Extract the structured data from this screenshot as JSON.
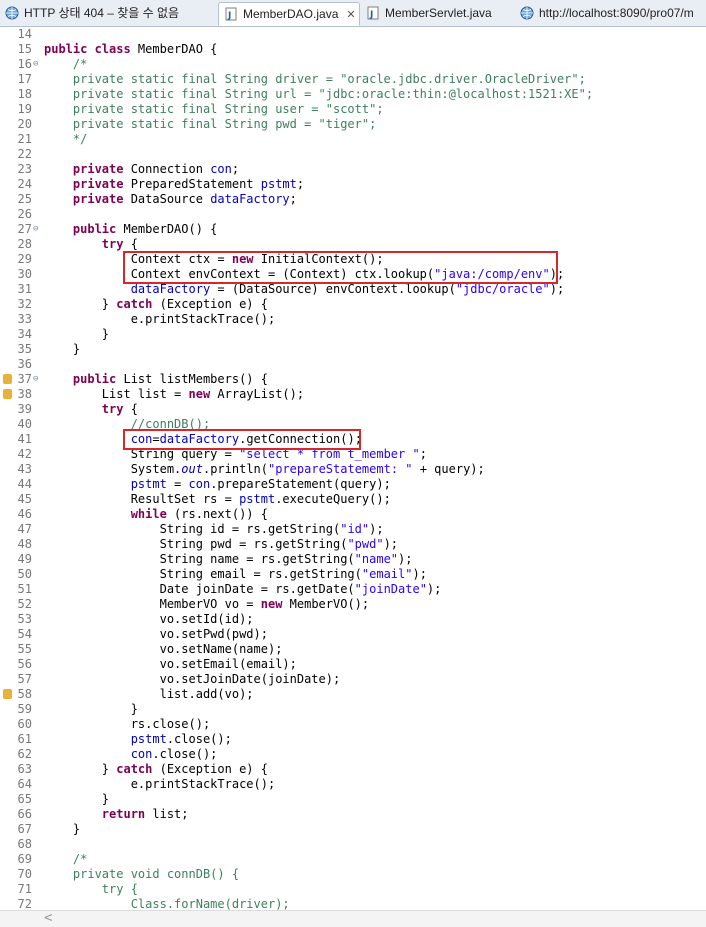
{
  "tabs": [
    {
      "label": "HTTP 상태 404 – 찾을 수 없음",
      "icon": "globe-icon",
      "active": false
    },
    {
      "label": "MemberDAO.java",
      "icon": "java-file-icon",
      "active": true,
      "close": "✕"
    },
    {
      "label": "MemberServlet.java",
      "icon": "java-file-icon",
      "active": false
    },
    {
      "label": "http://localhost:8090/pro07/m",
      "icon": "globe-icon",
      "active": false
    }
  ],
  "editor": {
    "lines": [
      {
        "n": "14",
        "t": []
      },
      {
        "n": "15",
        "t": [
          [
            "kw",
            "public class "
          ],
          [
            "",
            "MemberDAO {"
          ]
        ]
      },
      {
        "n": "16",
        "fold": true,
        "t": [
          [
            "cm",
            "    /*"
          ]
        ]
      },
      {
        "n": "17",
        "t": [
          [
            "cm",
            "    private static final String driver = \"oracle.jdbc.driver.OracleDriver\";"
          ]
        ]
      },
      {
        "n": "18",
        "t": [
          [
            "cm",
            "    private static final String url = \"jdbc:oracle:thin:@localhost:1521:XE\";"
          ]
        ]
      },
      {
        "n": "19",
        "t": [
          [
            "cm",
            "    private static final String user = \"scott\";"
          ]
        ]
      },
      {
        "n": "20",
        "t": [
          [
            "cm",
            "    private static final String pwd = \"tiger\";"
          ]
        ]
      },
      {
        "n": "21",
        "t": [
          [
            "cm",
            "    */"
          ]
        ]
      },
      {
        "n": "22",
        "t": []
      },
      {
        "n": "23",
        "t": [
          [
            "kw",
            "    private "
          ],
          [
            "",
            "Connection "
          ],
          [
            "fld",
            "con"
          ],
          [
            "",
            ";"
          ]
        ]
      },
      {
        "n": "24",
        "t": [
          [
            "kw",
            "    private "
          ],
          [
            "",
            "PreparedStatement "
          ],
          [
            "fld",
            "pstmt"
          ],
          [
            "",
            ";"
          ]
        ]
      },
      {
        "n": "25",
        "t": [
          [
            "kw",
            "    private "
          ],
          [
            "",
            "DataSource "
          ],
          [
            "fld",
            "dataFactory"
          ],
          [
            "",
            ";"
          ]
        ]
      },
      {
        "n": "26",
        "t": []
      },
      {
        "n": "27",
        "fold": true,
        "t": [
          [
            "kw",
            "    public "
          ],
          [
            "",
            "MemberDAO() {"
          ]
        ]
      },
      {
        "n": "28",
        "t": [
          [
            "kw",
            "        try "
          ],
          [
            "",
            "{"
          ]
        ]
      },
      {
        "n": "29",
        "t": [
          [
            "",
            "            Context ctx = "
          ],
          [
            "kw",
            "new "
          ],
          [
            "",
            "InitialContext();"
          ]
        ]
      },
      {
        "n": "30",
        "t": [
          [
            "",
            "            Context envContext = (Context) ctx.lookup("
          ],
          [
            "str",
            "\"java:/comp/env\""
          ],
          [
            "",
            ");"
          ]
        ]
      },
      {
        "n": "31",
        "t": [
          [
            "fld",
            "            dataFactory"
          ],
          [
            "",
            " = (DataSource) envContext.lookup("
          ],
          [
            "str",
            "\"jdbc/oracle\""
          ],
          [
            "",
            ");"
          ]
        ]
      },
      {
        "n": "32",
        "t": [
          [
            "",
            "        } "
          ],
          [
            "kw",
            "catch "
          ],
          [
            "",
            "(Exception e) {"
          ]
        ]
      },
      {
        "n": "33",
        "t": [
          [
            "",
            "            e.printStackTrace();"
          ]
        ]
      },
      {
        "n": "34",
        "t": [
          [
            "",
            "        }"
          ]
        ]
      },
      {
        "n": "35",
        "t": [
          [
            "",
            "    }"
          ]
        ]
      },
      {
        "n": "36",
        "t": []
      },
      {
        "n": "37",
        "fold": true,
        "mark": true,
        "t": [
          [
            "kw",
            "    public "
          ],
          [
            "",
            "List listMembers() {"
          ]
        ]
      },
      {
        "n": "38",
        "mark": true,
        "t": [
          [
            "",
            "        List list = "
          ],
          [
            "kw",
            "new "
          ],
          [
            "",
            "ArrayList();"
          ]
        ]
      },
      {
        "n": "39",
        "t": [
          [
            "kw",
            "        try "
          ],
          [
            "",
            "{"
          ]
        ]
      },
      {
        "n": "40",
        "t": [
          [
            "cm",
            "            //connDB();"
          ]
        ]
      },
      {
        "n": "41",
        "t": [
          [
            "fld",
            "            con"
          ],
          [
            "",
            "="
          ],
          [
            "fld",
            "dataFactory"
          ],
          [
            "",
            ".getConnection();"
          ]
        ]
      },
      {
        "n": "42",
        "t": [
          [
            "",
            "            String query = "
          ],
          [
            "str",
            "\"select * from t_member \""
          ],
          [
            "",
            ";"
          ]
        ]
      },
      {
        "n": "43",
        "t": [
          [
            "",
            "            System."
          ],
          [
            "fld it",
            "out"
          ],
          [
            "",
            ".println("
          ],
          [
            "str",
            "\"prepareStatememt: \""
          ],
          [
            "",
            " + query);"
          ]
        ]
      },
      {
        "n": "44",
        "t": [
          [
            "fld",
            "            pstmt"
          ],
          [
            "",
            " = "
          ],
          [
            "fld",
            "con"
          ],
          [
            "",
            ".prepareStatement(query);"
          ]
        ]
      },
      {
        "n": "45",
        "t": [
          [
            "",
            "            ResultSet rs = "
          ],
          [
            "fld",
            "pstmt"
          ],
          [
            "",
            ".executeQuery();"
          ]
        ]
      },
      {
        "n": "46",
        "t": [
          [
            "kw",
            "            while "
          ],
          [
            "",
            "(rs.next()) {"
          ]
        ]
      },
      {
        "n": "47",
        "t": [
          [
            "",
            "                String id = rs.getString("
          ],
          [
            "str",
            "\"id\""
          ],
          [
            "",
            ");"
          ]
        ]
      },
      {
        "n": "48",
        "t": [
          [
            "",
            "                String pwd = rs.getString("
          ],
          [
            "str",
            "\"pwd\""
          ],
          [
            "",
            ");"
          ]
        ]
      },
      {
        "n": "49",
        "t": [
          [
            "",
            "                String name = rs.getString("
          ],
          [
            "str",
            "\"name\""
          ],
          [
            "",
            ");"
          ]
        ]
      },
      {
        "n": "50",
        "t": [
          [
            "",
            "                String email = rs.getString("
          ],
          [
            "str",
            "\"email\""
          ],
          [
            "",
            ");"
          ]
        ]
      },
      {
        "n": "51",
        "t": [
          [
            "",
            "                Date joinDate = rs.getDate("
          ],
          [
            "str",
            "\"joinDate\""
          ],
          [
            "",
            ");"
          ]
        ]
      },
      {
        "n": "52",
        "t": [
          [
            "",
            "                MemberVO vo = "
          ],
          [
            "kw",
            "new "
          ],
          [
            "",
            "MemberVO();"
          ]
        ]
      },
      {
        "n": "53",
        "t": [
          [
            "",
            "                vo.setId(id);"
          ]
        ]
      },
      {
        "n": "54",
        "t": [
          [
            "",
            "                vo.setPwd(pwd);"
          ]
        ]
      },
      {
        "n": "55",
        "t": [
          [
            "",
            "                vo.setName(name);"
          ]
        ]
      },
      {
        "n": "56",
        "t": [
          [
            "",
            "                vo.setEmail(email);"
          ]
        ]
      },
      {
        "n": "57",
        "t": [
          [
            "",
            "                vo.setJoinDate(joinDate);"
          ]
        ]
      },
      {
        "n": "58",
        "mark": true,
        "t": [
          [
            "",
            "                list.add(vo);"
          ]
        ]
      },
      {
        "n": "59",
        "t": [
          [
            "",
            "            }"
          ]
        ]
      },
      {
        "n": "60",
        "t": [
          [
            "",
            "            rs.close();"
          ]
        ]
      },
      {
        "n": "61",
        "t": [
          [
            "fld",
            "            pstmt"
          ],
          [
            "",
            ".close();"
          ]
        ]
      },
      {
        "n": "62",
        "t": [
          [
            "fld",
            "            con"
          ],
          [
            "",
            ".close();"
          ]
        ]
      },
      {
        "n": "63",
        "t": [
          [
            "",
            "        } "
          ],
          [
            "kw",
            "catch "
          ],
          [
            "",
            "(Exception e) {"
          ]
        ]
      },
      {
        "n": "64",
        "t": [
          [
            "",
            "            e.printStackTrace();"
          ]
        ]
      },
      {
        "n": "65",
        "t": [
          [
            "",
            "        }"
          ]
        ]
      },
      {
        "n": "66",
        "t": [
          [
            "kw",
            "        return "
          ],
          [
            "",
            "list;"
          ]
        ]
      },
      {
        "n": "67",
        "t": [
          [
            "",
            "    }"
          ]
        ]
      },
      {
        "n": "68",
        "t": []
      },
      {
        "n": "69",
        "t": [
          [
            "cm",
            "    /*"
          ]
        ]
      },
      {
        "n": "70",
        "t": [
          [
            "cm",
            "    private void connDB() {"
          ]
        ]
      },
      {
        "n": "71",
        "t": [
          [
            "cm",
            "        try {"
          ]
        ]
      },
      {
        "n": "72",
        "t": [
          [
            "cm",
            "            Class.forName(driver);"
          ]
        ]
      }
    ]
  },
  "scrollbar": {
    "left_arrow": "<"
  }
}
